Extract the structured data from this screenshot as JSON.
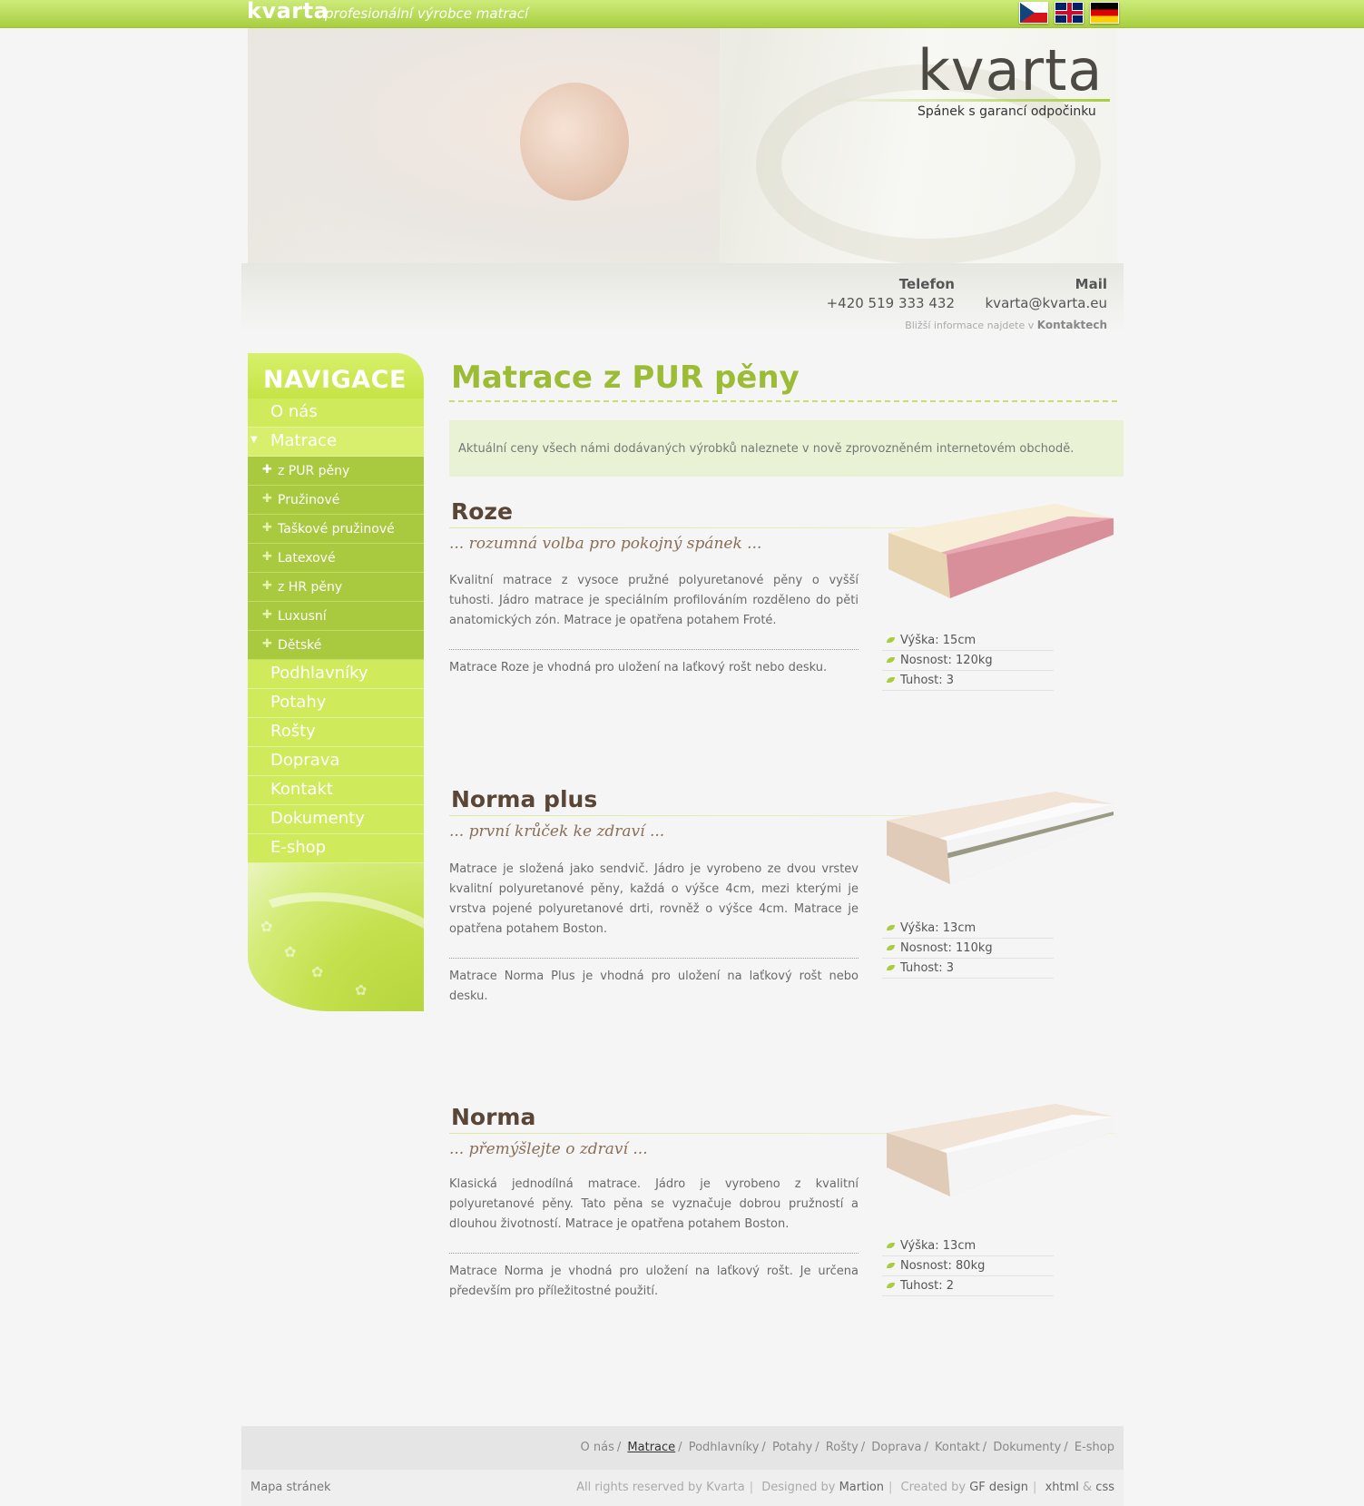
{
  "topbar": {
    "logo": "kvarta",
    "tagline": "profesionální výrobce matrací",
    "flags": [
      "czech-flag-icon",
      "uk-flag-icon",
      "german-flag-icon"
    ]
  },
  "header": {
    "logo": "kvarta",
    "slogan": "Spánek s garancí odpočinku",
    "phone_label": "Telefon",
    "phone": "+420 519 333 432",
    "mail_label": "Mail",
    "mail": "kvarta@kvarta.eu",
    "more_info": "Bližší informace najdete v",
    "more_info_link": "Kontaktech"
  },
  "nav": {
    "title": "NAVIGACE",
    "items": [
      {
        "label": "O nás"
      },
      {
        "label": "Matrace",
        "active": true
      },
      {
        "label": "Podhlavníky"
      },
      {
        "label": "Potahy"
      },
      {
        "label": "Rošty"
      },
      {
        "label": "Doprava"
      },
      {
        "label": "Kontakt"
      },
      {
        "label": "Dokumenty"
      },
      {
        "label": "E-shop"
      }
    ],
    "subitems": [
      {
        "label": "z PUR pěny",
        "active": true
      },
      {
        "label": "Pružinové"
      },
      {
        "label": "Taškové pružinové"
      },
      {
        "label": "Latexové"
      },
      {
        "label": "z HR pěny"
      },
      {
        "label": "Luxusní"
      },
      {
        "label": "Dětské"
      }
    ]
  },
  "content": {
    "title": "Matrace z PUR pěny",
    "notice": "Aktuální ceny všech námi dodávaných výrobků naleznete v nově zprovozněném internetovém obchodě.",
    "products": [
      {
        "name": "Roze",
        "motto": "... rozumná volba pro pokojný spánek ...",
        "description": "Kvalitní matrace z vysoce pružné polyuretanové pěny o vyšší tuhosti. Jádro matrace je speciálním profilováním rozděleno do pěti anatomických zón. Matrace je opatřena potahem Froté.",
        "note": "Matrace Roze je vhodná pro uložení na laťkový rošt nebo desku.",
        "specs": [
          "Výška: 15cm",
          "Nosnost: 120kg",
          "Tuhost: 3"
        ]
      },
      {
        "name": "Norma plus",
        "motto": "... první krůček ke zdraví ...",
        "description": "Matrace je složená jako sendvič. Jádro je vyrobeno ze dvou vrstev kvalitní polyuretanové pěny, každá o výšce 4cm, mezi kterými je vrstva pojené polyuretanové drti, rovněž o výšce 4cm. Matrace je opatřena potahem Boston.",
        "note": "Matrace Norma Plus je vhodná pro uložení na laťkový rošt nebo desku.",
        "specs": [
          "Výška: 13cm",
          "Nosnost: 110kg",
          "Tuhost: 3"
        ]
      },
      {
        "name": "Norma",
        "motto": "... přemýšlejte o zdraví ...",
        "description": "Klasická jednodílná matrace. Jádro je vyrobeno z kvalitní polyuretanové pěny. Tato pěna se vyznačuje dobrou pružností a dlouhou životností. Matrace je opatřena potahem Boston.",
        "note": "Matrace Norma je vhodná pro uložení na laťkový rošt. Je určena především pro příležitostné použití.",
        "specs": [
          "Výška: 13cm",
          "Nosnost: 80kg",
          "Tuhost: 2"
        ]
      }
    ]
  },
  "footer": {
    "links": [
      "O nás",
      "Matrace",
      "Podhlavníky",
      "Potahy",
      "Rošty",
      "Doprava",
      "Kontakt",
      "Dokumenty",
      "E-shop"
    ],
    "active_link": "Matrace",
    "sitemap": "Mapa stránek",
    "rights": "All rights reserved by Kvarta",
    "designed_by": "Designed by",
    "designer": "Martion",
    "created_by": "Created by",
    "creator": "GF design",
    "xhtml": "xhtml",
    "amp": "&",
    "css": "css"
  },
  "colors": {
    "accent": "#a9cd3d",
    "title_green": "#9cbc36",
    "product_title": "#5a4636",
    "motto": "#8a6e56"
  }
}
